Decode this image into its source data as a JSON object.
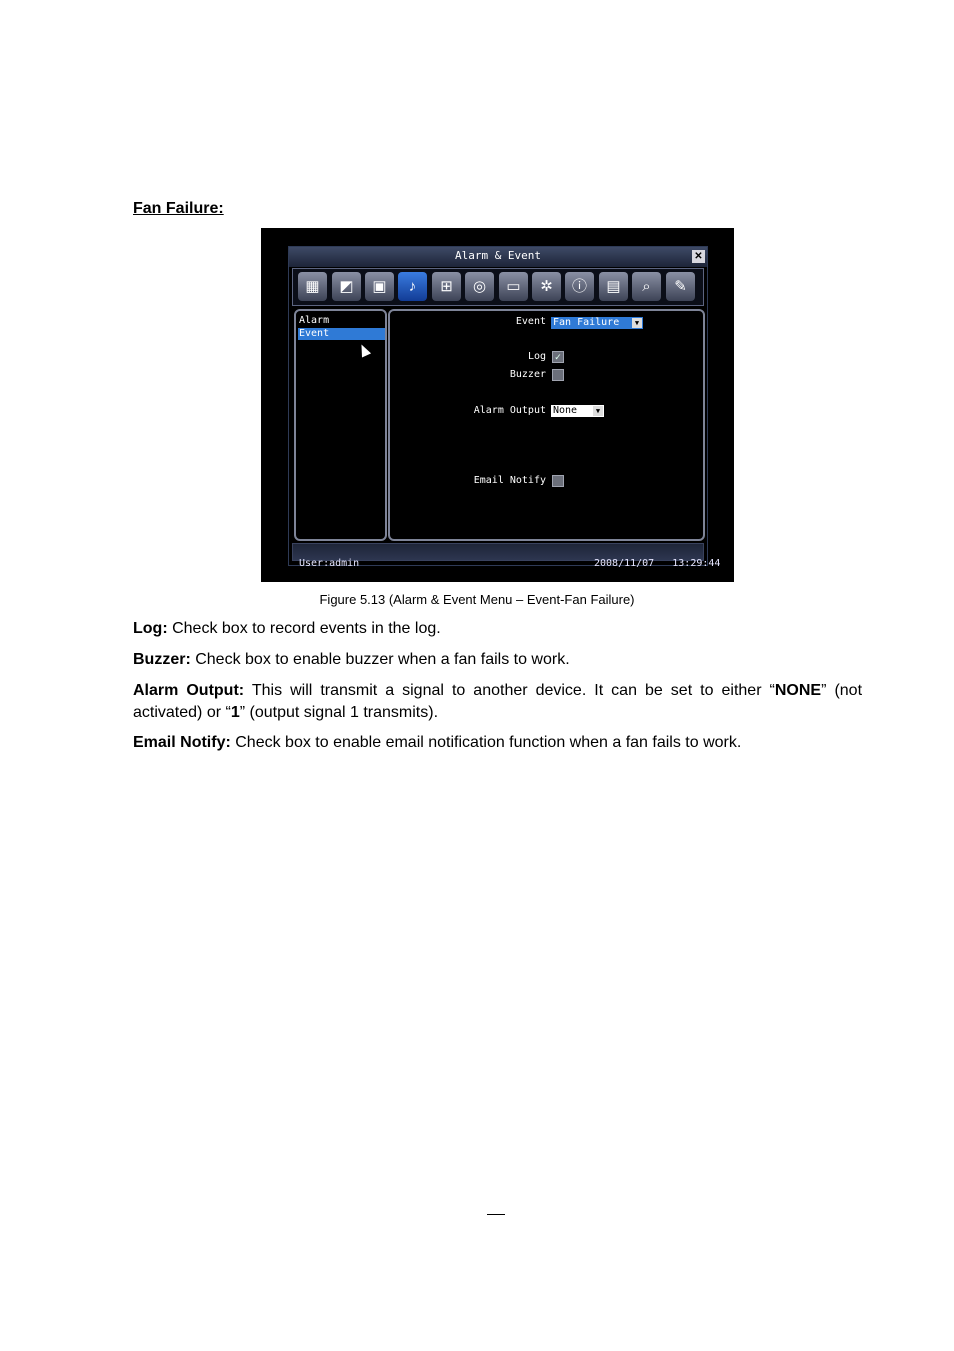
{
  "heading": "Fan Failure:",
  "dvr": {
    "title": "Alarm & Event",
    "close_glyph": "✕",
    "toolbar_icons": [
      "film-icon",
      "camera-icon",
      "record-icon",
      "alarm-bell-icon",
      "network-icon",
      "disk-icon",
      "display-icon",
      "gear-icon",
      "info-icon",
      "log-icon",
      "search-icon",
      "tools-icon"
    ],
    "left_items": [
      "Alarm",
      "Event"
    ],
    "event_label": "Event",
    "event_value": "Fan Failure",
    "log_label": "Log",
    "log_checked": true,
    "buzzer_label": "Buzzer",
    "buzzer_checked": false,
    "alarm_output_label": "Alarm Output",
    "alarm_output_value": "None",
    "email_label": "Email Notify",
    "email_checked": false,
    "user": "User:admin",
    "datetime": "2008/11/07   13:29:44",
    "colors": {
      "selection": "#2f7ad6",
      "frame": "#7e8498"
    }
  },
  "caption": "Figure 5.13 (Alarm & Event Menu – Event-Fan Failure)",
  "paragraphs": {
    "log_term": "Log:",
    "log_text": " Check box to record events in the log.",
    "buzzer_term": "Buzzer:",
    "buzzer_text": " Check box to enable buzzer when a fan fails to work.",
    "alarm_term": "Alarm Output:",
    "alarm_text1": " This will transmit a signal to another device. It can be set to either “",
    "alarm_none": "NONE",
    "alarm_text2": "” (not activated) or “",
    "alarm_one": "1",
    "alarm_text3": "” (output signal 1 transmits).",
    "email_term": "Email Notify:",
    "email_text": " Check box to enable email notification function when a fan fails to work."
  }
}
